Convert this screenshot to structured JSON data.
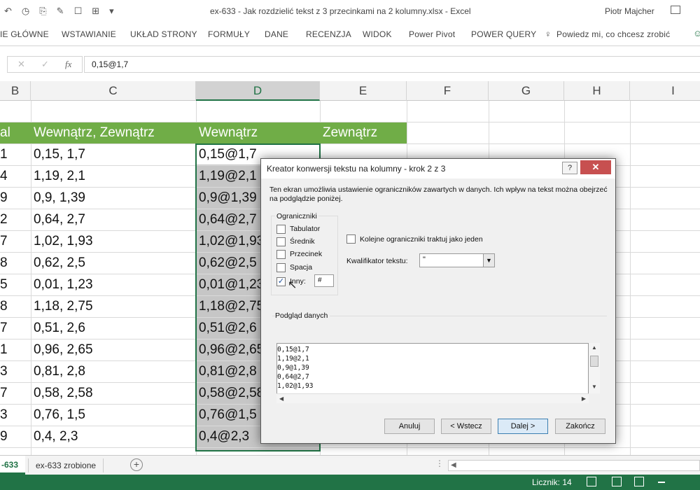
{
  "window": {
    "title": "ex-633 - Jak rozdzielić tekst z 3 przecinkami na 2 kolumny.xlsx - Excel",
    "user": "Piotr Majcher"
  },
  "qat": {
    "icons": [
      "save-icon",
      "undo-icon",
      "redo-icon",
      "clipboard-icon",
      "paint-icon",
      "brush-icon",
      "table-icon",
      "dropdown-icon"
    ],
    "glyphs": [
      "↶",
      "◷",
      "⎘",
      "✎",
      "☐",
      "⊞",
      "▾",
      "⯆"
    ]
  },
  "ribbon": {
    "tabs": [
      "IE GŁÓWNE",
      "WSTAWIANIE",
      "UKŁAD STRONY",
      "FORMUŁY",
      "DANE",
      "RECENZJA",
      "WIDOK",
      "Power Pivot",
      "POWER QUERY"
    ],
    "tell_me": "Powiedz mi, co chcesz zrobić"
  },
  "formula_bar": {
    "cancel": "✕",
    "enter": "✓",
    "fx": "fx",
    "value": "0,15@1,7"
  },
  "columns": [
    "B",
    "C",
    "D",
    "E",
    "F",
    "G",
    "H",
    "I"
  ],
  "selected_column": "D",
  "header_row": {
    "b": "al",
    "c": "Wewnątrz, Zewnątrz",
    "d": "Wewnątrz",
    "e": "Zewnątrz"
  },
  "rows": [
    {
      "b": "1",
      "c": "0,15, 1,7",
      "d": "0,15@1,7"
    },
    {
      "b": "4",
      "c": "1,19, 2,1",
      "d": "1,19@2,1"
    },
    {
      "b": "9",
      "c": "0,9, 1,39",
      "d": "0,9@1,39"
    },
    {
      "b": "2",
      "c": "0,64, 2,7",
      "d": "0,64@2,7"
    },
    {
      "b": "7",
      "c": "1,02, 1,93",
      "d": "1,02@1,93"
    },
    {
      "b": "8",
      "c": "0,62, 2,5",
      "d": "0,62@2,5"
    },
    {
      "b": "5",
      "c": "0,01, 1,23",
      "d": "0,01@1,23"
    },
    {
      "b": "8",
      "c": "1,18, 2,75",
      "d": "1,18@2,75"
    },
    {
      "b": "7",
      "c": "0,51, 2,6",
      "d": "0,51@2,6"
    },
    {
      "b": "1",
      "c": "0,96, 2,65",
      "d": "0,96@2,65"
    },
    {
      "b": "3",
      "c": "0,81, 2,8",
      "d": "0,81@2,8"
    },
    {
      "b": "7",
      "c": "0,58, 2,58",
      "d": "0,58@2,58"
    },
    {
      "b": "3",
      "c": "0,76, 1,5",
      "d": "0,76@1,5"
    },
    {
      "b": "9",
      "c": "0,4, 2,3",
      "d": "0,4@2,3"
    }
  ],
  "sheet_tabs": {
    "active": "-633",
    "other": "ex-633 zrobione",
    "add": "+",
    "more": "⋮"
  },
  "status": {
    "count": "Licznik: 14"
  },
  "dialog": {
    "title": "Kreator konwersji tekstu na kolumny - krok 2 z 3",
    "help": "?",
    "close": "✕",
    "description": "Ten ekran umożliwia ustawienie ograniczników zawartych w danych. Ich wpływ na tekst można obejrzeć na podglądzie poniżej.",
    "group_label": "Ograniczniki",
    "delimiters": [
      {
        "label": "Tabulator",
        "checked": false
      },
      {
        "label": "Średnik",
        "checked": false
      },
      {
        "label": "Przecinek",
        "checked": false
      },
      {
        "label": "Spacja",
        "checked": false
      },
      {
        "label": "Inny:",
        "checked": true
      }
    ],
    "other_value": "#",
    "consecutive_label": "Kolejne ograniczniki traktuj jako jeden",
    "qualifier_label": "Kwalifikator tekstu:",
    "qualifier_value": "\"",
    "preview_label": "Podgląd danych",
    "preview_lines": "0,15@1,7\n1,19@2,1\n0,9@1,39\n0,64@2,7\n1,02@1,93",
    "buttons": {
      "cancel": "Anuluj",
      "back": "< Wstecz",
      "next": "Dalej >",
      "finish": "Zakończ"
    }
  },
  "colors": {
    "excel_green": "#217346",
    "header_green": "#70ad47",
    "selection_grey": "#c6c6c6"
  }
}
